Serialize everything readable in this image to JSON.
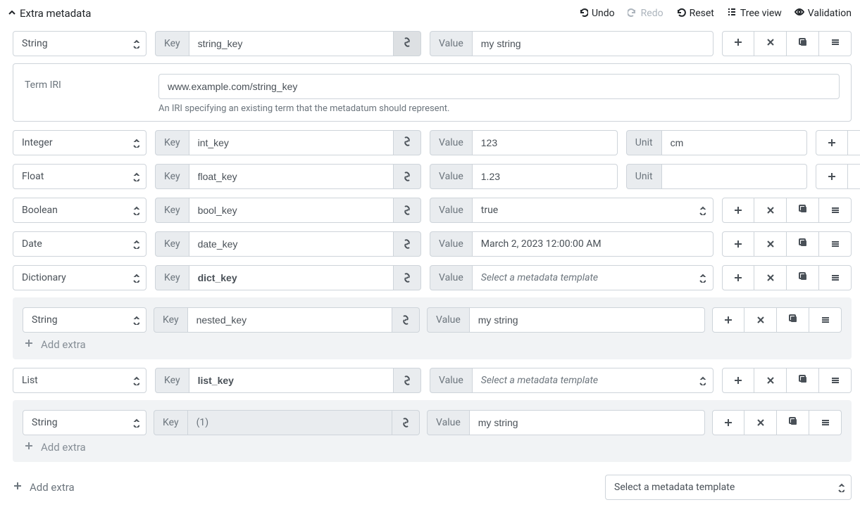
{
  "header": {
    "title": "Extra metadata",
    "undo": "Undo",
    "redo": "Redo",
    "reset": "Reset",
    "tree_view": "Tree view",
    "validation": "Validation"
  },
  "labels": {
    "key": "Key",
    "value": "Value",
    "unit": "Unit",
    "term_iri": "Term IRI",
    "add_extra": "Add extra",
    "select_template": "Select a metadata template"
  },
  "iri_help": "An IRI specifying an existing term that the metadatum should represent.",
  "rows": {
    "string": {
      "type": "String",
      "key": "string_key",
      "value": "my string",
      "iri": "www.example.com/string_key"
    },
    "integer": {
      "type": "Integer",
      "key": "int_key",
      "value": "123",
      "unit": "cm"
    },
    "float": {
      "type": "Float",
      "key": "float_key",
      "value": "1.23",
      "unit": ""
    },
    "boolean": {
      "type": "Boolean",
      "key": "bool_key",
      "value": "true"
    },
    "date": {
      "type": "Date",
      "key": "date_key",
      "value": "March 2, 2023 12:00:00 AM"
    },
    "dictionary": {
      "type": "Dictionary",
      "key": "dict_key",
      "child": {
        "type": "String",
        "key": "nested_key",
        "value": "my string"
      }
    },
    "list": {
      "type": "List",
      "key": "list_key",
      "child": {
        "type": "String",
        "key": "(1)",
        "value": "my string"
      }
    }
  }
}
